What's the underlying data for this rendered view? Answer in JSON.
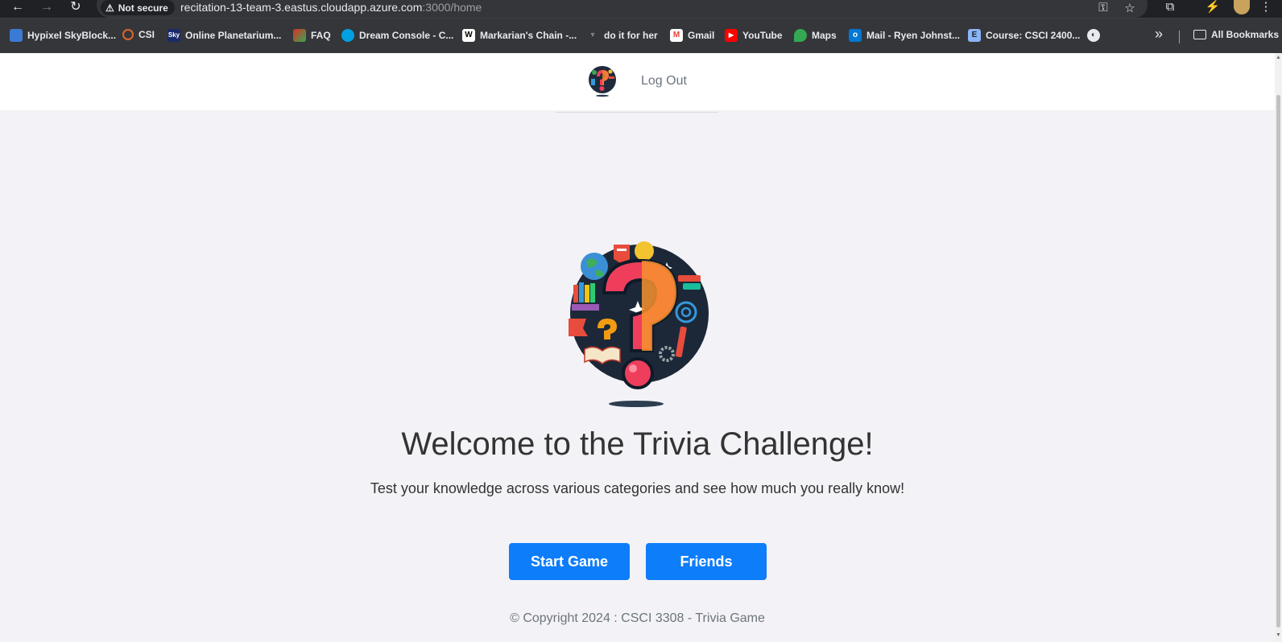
{
  "browser": {
    "security_label": "Not secure",
    "url_host": "recitation-13-team-3.eastus.cloudapp.azure.com",
    "url_rest": ":3000/home"
  },
  "bookmarks": [
    {
      "label": "Hypixel SkyBlock...",
      "icon": "cube-icon",
      "color": "#3b7bd4"
    },
    {
      "label": "CSI",
      "icon": "ring-icon",
      "color": "#e0652b"
    },
    {
      "label": "Online Planetarium...",
      "icon": "sky-icon",
      "color": "#1a2a6c"
    },
    {
      "label": "FAQ",
      "icon": "flag-icon",
      "color": "#d93025"
    },
    {
      "label": "Dream Console - C...",
      "icon": "cloud-icon",
      "color": "#00a1e0"
    },
    {
      "label": "Markarian's Chain -...",
      "icon": "wikipedia-icon",
      "color": "#ffffff"
    },
    {
      "label": "do it for her",
      "icon": "figure-icon",
      "color": "#202124"
    },
    {
      "label": "Gmail",
      "icon": "gmail-icon",
      "color": "#ea4335"
    },
    {
      "label": "YouTube",
      "icon": "youtube-icon",
      "color": "#ff0000"
    },
    {
      "label": "Maps",
      "icon": "maps-icon",
      "color": "#34a853"
    },
    {
      "label": "Mail - Ryen Johnst...",
      "icon": "outlook-icon",
      "color": "#0078d4"
    },
    {
      "label": "Course: CSCI 2400...",
      "icon": "course-icon",
      "color": "#8ab4f8"
    },
    {
      "label": "",
      "icon": "globe-icon",
      "color": "#e8eaed"
    }
  ],
  "all_bookmarks_label": "All Bookmarks",
  "site_nav": {
    "logout_label": "Log Out"
  },
  "hero": {
    "title": "Welcome to the Trivia Challenge!",
    "subtitle": "Test your knowledge across various categories and see how much you really know!",
    "start_label": "Start Game",
    "friends_label": "Friends"
  },
  "footer": {
    "text": "© Copyright 2024 : CSCI 3308 - Trivia Game"
  },
  "colors": {
    "primary_button": "#0d7dfa",
    "page_background": "#f3f2f6",
    "nav_background": "#ffffff"
  }
}
